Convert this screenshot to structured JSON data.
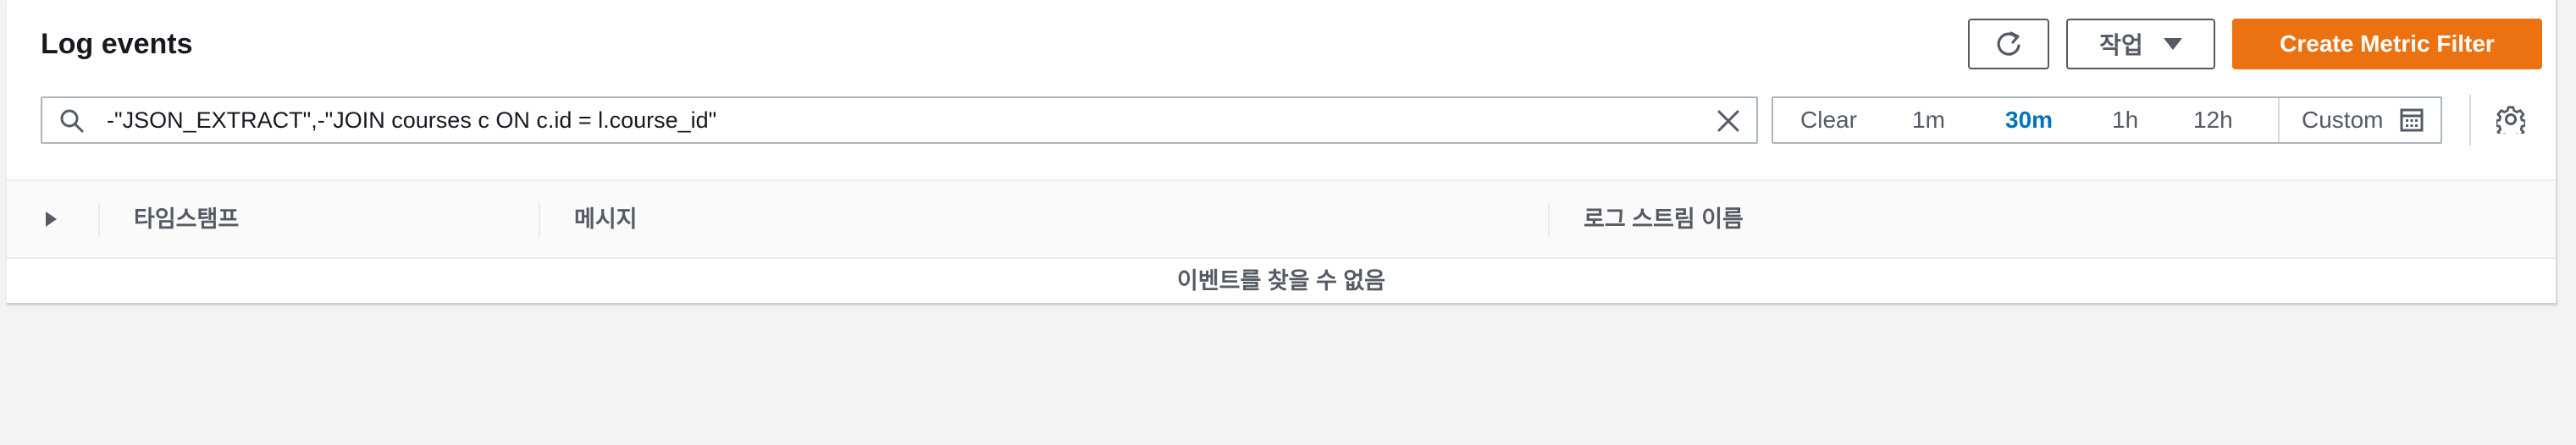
{
  "header": {
    "title": "Log events",
    "actions_label": "작업",
    "create_metric_filter_label": "Create Metric Filter"
  },
  "search": {
    "value": "-\"JSON_EXTRACT\",-\"JOIN courses c ON c.id = l.course_id\""
  },
  "time_range": {
    "clear_label": "Clear",
    "options": [
      "1m",
      "30m",
      "1h",
      "12h"
    ],
    "selected": "30m",
    "custom_label": "Custom"
  },
  "table": {
    "columns": [
      "타임스탬프",
      "메시지",
      "로그 스트림 이름"
    ],
    "empty_message": "이벤트를 찾을 수 없음"
  },
  "colors": {
    "primary": "#ec7211",
    "active_link": "#0073bb",
    "text_secondary": "#545b64"
  },
  "icons": [
    "refresh-icon",
    "caret-down-icon",
    "search-icon",
    "close-icon",
    "calendar-icon",
    "gear-icon",
    "expand-caret-icon"
  ]
}
